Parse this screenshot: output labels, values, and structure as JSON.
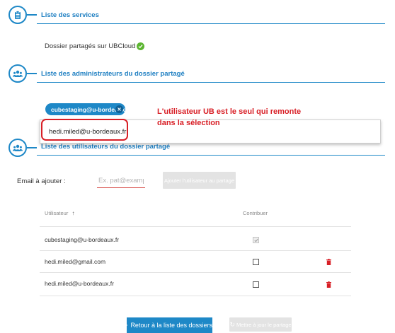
{
  "sections": {
    "services": {
      "title": "Liste des services",
      "icon": "clipboard-icon"
    },
    "admins": {
      "title": "Liste des administrateurs du dossier partagé",
      "icon": "users-icon"
    },
    "users": {
      "title": "Liste des utilisateurs du dossier partagé",
      "icon": "users-icon"
    }
  },
  "service": {
    "label": "Dossier partagés sur UBCloud",
    "status_icon": "check-circle-icon",
    "status_color": "#5cb531"
  },
  "admins": {
    "chip_label": "cubestaging@u-bordeaux.fr",
    "dropdown_option": "hedi.miled@u-bordeaux.fr"
  },
  "annotation": {
    "line1": "L'utilisateur UB est le seul qui remonte",
    "line2": "dans la sélection",
    "color": "#d81f26"
  },
  "form": {
    "email_label": "Email à ajouter :",
    "email_placeholder": "Ex. pat@example.com",
    "add_button": "Ajouter l'utilisateur au partage"
  },
  "table": {
    "col_user": "Utilisateur",
    "col_contribute": "Contribuer",
    "rows": [
      {
        "email": "cubestaging@u-bordeaux.fr",
        "contribute": true,
        "deletable": false
      },
      {
        "email": "hedi.miled@gmail.com",
        "contribute": false,
        "deletable": true
      },
      {
        "email": "hedi.miled@u-bordeaux.fr",
        "contribute": false,
        "deletable": true
      }
    ]
  },
  "footer": {
    "back_button": "Retour à la liste des dossiers",
    "update_button": "Mettre à jour le partage"
  },
  "colors": {
    "accent": "#1e88c7",
    "danger": "#d81f26",
    "success": "#5cb531"
  }
}
